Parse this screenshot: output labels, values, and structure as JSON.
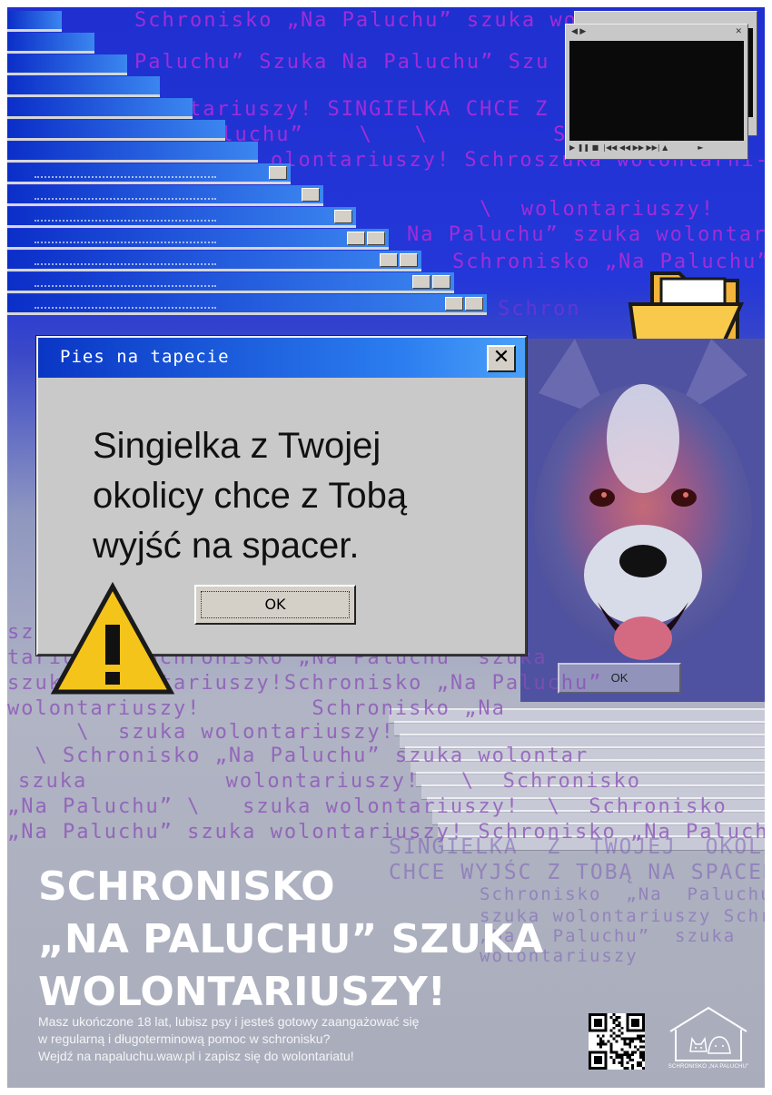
{
  "background_text": [
    "Schronisko „Na Paluchu” szuka wolon",
    "Paluchu” Szuka Na Paluchu” Szu",
    "tariuszy! SINGIELKA CHCE Z",
    "aluchu”    \\   \\         Sch",
    "olontariuszy! Schroszuka wolontarni-",
    "\\  wolontariuszy!",
    "Na Paluchu” szuka wolontar",
    "Schronisko „Na Paluchu”",
    "Schron     wo"
  ],
  "lower_text": [
    "sz",
    "tariuszy! Schronisko „Na Paluchu” szuka",
    "szuka wolontariuszy!Schronisko „Na Paluchu”",
    "wolontariuszy!        Schronisko „Na",
    "     \\  szuka wolontariuszy!",
    "  \\ Schronisko „Na Paluchu” szuka wolontar",
    "szuka          wolontariuszy!   \\  Schronisko",
    "„Na Paluchu” \\   szuka wolontariuszy!  \\  Schronisko",
    "„Na Paluchu” szuka wolontariuszy! Schronisko „Na Paluchu"
  ],
  "ghost_text": [
    "SINGIELKA  Z  TWOJEJ  OKOLICY",
    "CHCE WYJŚC Z TOBĄ NA SPACER",
    "Schronisko  „Na  Paluchu”",
    "szuka wolontariuszy Schronisko",
    "„Na   Paluchu”  szuka",
    "wolontariuszy"
  ],
  "dialog": {
    "title": "Pies na tapecie",
    "close_label": "✕",
    "message": "Singielka z Twojej okolicy chce z Tobą wyjść na spacer.",
    "ok_label": "OK"
  },
  "dog_dialog": {
    "ok_label": "OK"
  },
  "headline": {
    "line1": "SCHRONISKO",
    "line2": "„NA PALUCHU” SZUKA",
    "line3": "WOLONTARIUSZY!"
  },
  "body_text": {
    "line1": "Masz ukończone 18 lat, lubisz psy i jesteś gotowy zaangażować się",
    "line2": "w regularną i długoterminową pomoc w schronisku?",
    "line3": "Wejdź na napaluchu.waw.pl i zapisz się do wolontariatu!"
  },
  "logo": {
    "caption": "SCHRONISKO „NA PALUCHU”"
  },
  "icons": {
    "warning": "warning-icon",
    "folder": "folder-icon",
    "qr": "qr-code-icon",
    "logo": "shelter-logo-icon"
  },
  "colors": {
    "title_bar": "#0a36c4",
    "background_top": "#1f2fd0",
    "text_purple": "#b02cd8",
    "warning_yellow": "#f5c41a",
    "folder_yellow": "#f8c94a"
  }
}
